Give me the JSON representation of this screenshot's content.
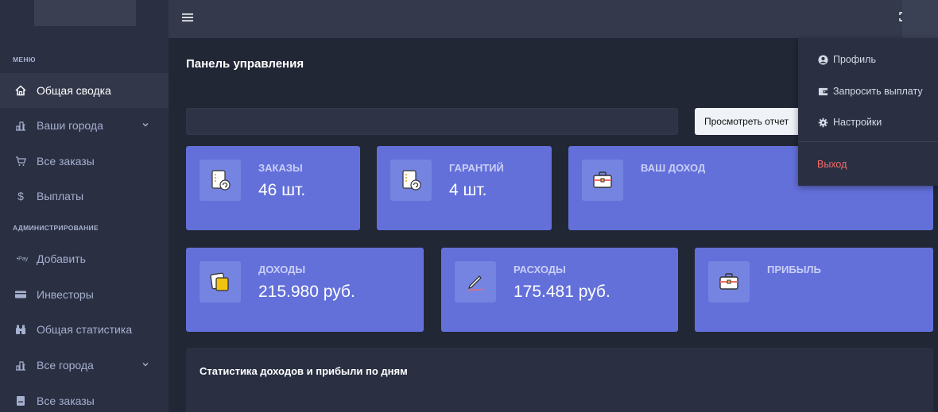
{
  "sidebar": {
    "section_menu": "МЕНЮ",
    "section_admin": "АДМИНИСТРИРОВАНИЕ",
    "items": [
      {
        "label": "Общая сводка",
        "icon": "home-icon"
      },
      {
        "label": "Ваши города",
        "icon": "city-icon"
      },
      {
        "label": "Все заказы",
        "icon": "cart-icon"
      },
      {
        "label": "Выплаты",
        "icon": "dollar-icon"
      },
      {
        "label": "Добавить",
        "icon": "pay-icon"
      },
      {
        "label": "Инвесторы",
        "icon": "card-icon"
      },
      {
        "label": "Общая статистика",
        "icon": "binoculars-icon"
      },
      {
        "label": "Все города",
        "icon": "city-icon"
      },
      {
        "label": "Все заказы",
        "icon": "document-icon"
      }
    ],
    "pay_glyph": "•Pay"
  },
  "main": {
    "title": "Панель управления",
    "report_button": "Просмотреть отчет",
    "cards_row1": [
      {
        "title": "ЗАКАЗЫ",
        "value": "46 шт.",
        "icon": "order-list-icon"
      },
      {
        "title": "ГАРАНТИЙ",
        "value": "4 шт.",
        "icon": "order-list-icon"
      },
      {
        "title": "ВАШ ДОХОД",
        "value": "",
        "icon": "briefcase-icon"
      }
    ],
    "cards_row2": [
      {
        "title": "ДОХОДЫ",
        "value": "215.980 руб.",
        "icon": "notes-icon"
      },
      {
        "title": "РАСХОДЫ",
        "value": "175.481 руб.",
        "icon": "pen-icon"
      },
      {
        "title": "ПРИБЫЛЬ",
        "value": "",
        "icon": "briefcase-icon"
      }
    ],
    "stats_title": "Статистика доходов и прибыли по дням"
  },
  "dropdown": {
    "profile": "Профиль",
    "payout": "Запросить выплату",
    "settings": "Настройки",
    "logout": "Выход"
  },
  "colors": {
    "card": "#6370da",
    "sidebar": "#2a3042",
    "background": "#222736",
    "logout": "#f46a6a"
  }
}
